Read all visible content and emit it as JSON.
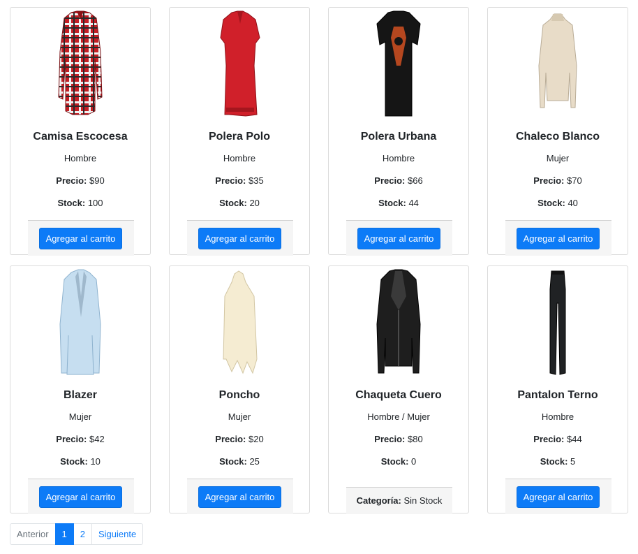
{
  "products": [
    {
      "name": "Camisa Escocesa",
      "category": "Hombre",
      "price_label": "Precio:",
      "price": " $90",
      "stock_label": "Stock:",
      "stock": " 100",
      "button": "Agregar al carrito",
      "image": "plaid-shirt"
    },
    {
      "name": "Polera Polo",
      "category": "Hombre",
      "price_label": "Precio:",
      "price": " $35",
      "stock_label": "Stock:",
      "stock": " 20",
      "button": "Agregar al carrito",
      "image": "red-polo"
    },
    {
      "name": "Polera Urbana",
      "category": "Hombre",
      "price_label": "Precio:",
      "price": " $66",
      "stock_label": "Stock:",
      "stock": " 44",
      "button": "Agregar al carrito",
      "image": "black-tshirt"
    },
    {
      "name": "Chaleco Blanco",
      "category": "Mujer",
      "price_label": "Precio:",
      "price": " $70",
      "stock_label": "Stock:",
      "stock": " 40",
      "button": "Agregar al carrito",
      "image": "white-sweater"
    },
    {
      "name": "Blazer",
      "category": "Mujer",
      "price_label": "Precio:",
      "price": " $42",
      "stock_label": "Stock:",
      "stock": " 10",
      "button": "Agregar al carrito",
      "image": "blue-blazer"
    },
    {
      "name": "Poncho",
      "category": "Mujer",
      "price_label": "Precio:",
      "price": " $20",
      "stock_label": "Stock:",
      "stock": " 25",
      "button": "Agregar al carrito",
      "image": "cream-poncho"
    },
    {
      "name": "Chaqueta Cuero",
      "category": "Hombre / Mujer",
      "price_label": "Precio:",
      "price": " $80",
      "stock_label": "Stock:",
      "stock": " 0",
      "category_label": "Categoría:",
      "out_of_stock": " Sin Stock",
      "image": "leather-jacket"
    },
    {
      "name": "Pantalon Terno",
      "category": "Hombre",
      "price_label": "Precio:",
      "price": " $44",
      "stock_label": "Stock:",
      "stock": " 5",
      "button": "Agregar al carrito",
      "image": "black-pants"
    }
  ],
  "pagination": {
    "prev": "Anterior",
    "pages": [
      "1",
      "2"
    ],
    "active": "1",
    "next": "Siguiente"
  },
  "colors": {
    "primary": "#0d7bf7"
  }
}
